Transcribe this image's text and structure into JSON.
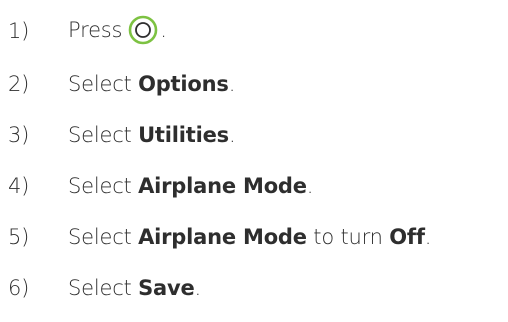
{
  "steps": [
    {
      "number": "1)",
      "verb": "Press",
      "end": ".",
      "icon": "home-button-icon",
      "icon_color": "#7dc242"
    },
    {
      "number": "2)",
      "verb": "Select",
      "bold": "Options",
      "end": "."
    },
    {
      "number": "3)",
      "verb": "Select",
      "bold": "Utilities",
      "end": "."
    },
    {
      "number": "4)",
      "verb": "Select",
      "bold": "Airplane Mode",
      "end": "."
    },
    {
      "number": "5)",
      "verb": "Select",
      "bold": "Airplane Mode",
      "mid": "to turn",
      "bold2": "Off",
      "end": "."
    },
    {
      "number": "6)",
      "verb": "Select",
      "bold": "Save",
      "end": "."
    }
  ],
  "colors": {
    "text": "#2e2e2e",
    "accent": "#7dc242",
    "background": "#ffffff"
  }
}
